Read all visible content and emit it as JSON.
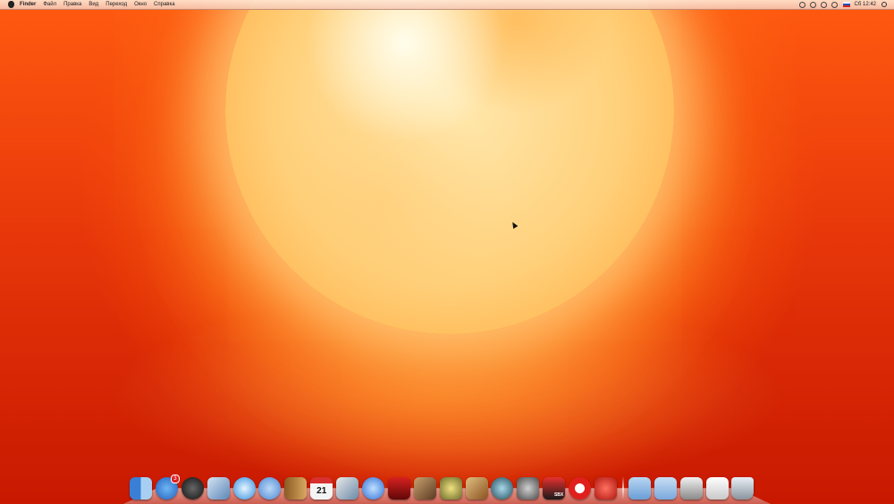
{
  "menubar": {
    "items": [
      "Finder",
      "Файл",
      "Правка",
      "Вид",
      "Переход",
      "Окно",
      "Справка"
    ],
    "clock": "Сб 12:42"
  },
  "dock": {
    "app_store_badge": "3",
    "calendar_date": "21",
    "sbx_label": "SBX",
    "apps": [
      {
        "name": "finder-icon",
        "color": "#4a8fe0"
      },
      {
        "name": "app-store-icon",
        "color": "#2f7fe0"
      },
      {
        "name": "dashboard-icon",
        "color": "#333333"
      },
      {
        "name": "preview-icon",
        "color": "#6b8fb8"
      },
      {
        "name": "safari-icon",
        "color": "#4fa7e8"
      },
      {
        "name": "facetime-icon",
        "color": "#7ab0e8"
      },
      {
        "name": "address-book-icon",
        "color": "#c6903e"
      },
      {
        "name": "ical-icon",
        "color": "#f2f2f2"
      },
      {
        "name": "iphoto-icon",
        "color": "#8aa0b4"
      },
      {
        "name": "itunes-icon",
        "color": "#4a7fe0"
      },
      {
        "name": "photo-booth-icon",
        "color": "#b01818"
      },
      {
        "name": "image-capture-icon",
        "color": "#7a5a3a"
      },
      {
        "name": "imovie-icon",
        "color": "#8a8a4a"
      },
      {
        "name": "garageband-icon",
        "color": "#a07040"
      },
      {
        "name": "time-machine-icon",
        "color": "#3a6a7a"
      },
      {
        "name": "system-preferences-icon",
        "color": "#8a8a8a"
      },
      {
        "name": "sandboxie-sbx-icon",
        "color": "#c42020"
      },
      {
        "name": "opera-icon",
        "color": "#e0201c"
      },
      {
        "name": "pokerstars-icon",
        "color": "#d4281e"
      }
    ],
    "stacks": [
      {
        "name": "applications-folder-icon",
        "color": "#8ab4e0"
      },
      {
        "name": "documents-folder-icon",
        "color": "#9fc0e6"
      },
      {
        "name": "downloads-stack-icon",
        "color": "#d8d8d8"
      },
      {
        "name": "document-stack-icon",
        "color": "#f0f0f0"
      },
      {
        "name": "trash-icon",
        "color": "#c8d0d8"
      }
    ]
  }
}
